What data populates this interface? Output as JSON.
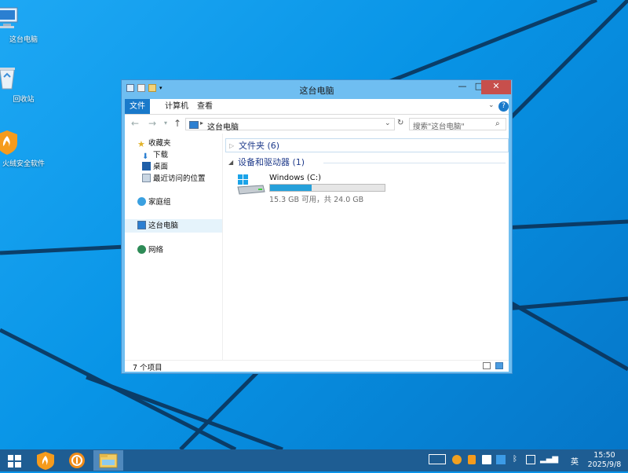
{
  "desktop": {
    "icons": [
      {
        "label": "这台电脑",
        "icon": "computer-icon"
      },
      {
        "label": "回收站",
        "icon": "recycle-bin-icon"
      },
      {
        "label": "火绒安全软件",
        "icon": "huorong-icon"
      }
    ]
  },
  "window": {
    "title": "这台电脑",
    "ribbon_tabs": [
      "文件",
      "计算机",
      "查看"
    ],
    "address": "这台电脑",
    "search_placeholder": "搜索\"这台电脑\"",
    "nav": {
      "favorites": "收藏夹",
      "downloads": "下载",
      "desktop": "桌面",
      "recent": "最近访问的位置",
      "homegroup": "家庭组",
      "this_pc": "这台电脑",
      "network": "网络"
    },
    "groups": {
      "folders": "文件夹 (6)",
      "drives": "设备和驱动器 (1)"
    },
    "drive": {
      "name": "Windows (C:)",
      "free_text": "15.3 GB 可用，共 24.0 GB",
      "used_fraction": 0.36
    },
    "status": {
      "count": "7 个项目"
    }
  },
  "taskbar": {
    "apps": [
      "start-icon",
      "huorong-icon",
      "app-icon",
      "file-explorer-icon"
    ],
    "tray": {
      "ime": "英"
    },
    "clock": {
      "time": "15:50",
      "date": "2025/9/8"
    }
  },
  "colors": {
    "accent": "#1979ca",
    "close": "#c74f4c",
    "taskbar": "#1e5d93"
  }
}
